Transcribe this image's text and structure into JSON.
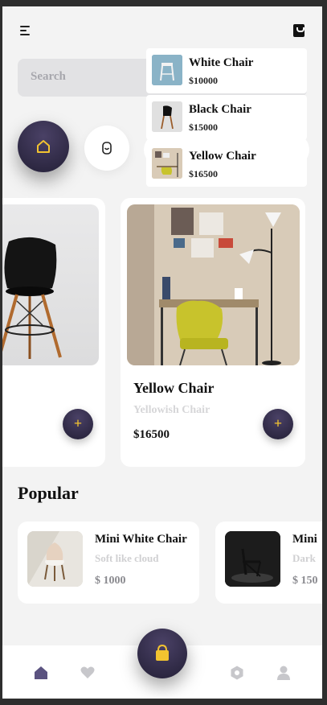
{
  "search": {
    "placeholder": "Search"
  },
  "dropdown": [
    {
      "name": "White Chair",
      "price": "$10000"
    },
    {
      "name": "Black Chair",
      "price": "$15000"
    },
    {
      "name": "Yellow Chair",
      "price": "$16500"
    }
  ],
  "featured": [
    {
      "title_visible": "r"
    },
    {
      "title": "Yellow Chair",
      "subtitle": "Yellowish Chair",
      "price": "$16500",
      "add": "+"
    }
  ],
  "featured_first_add": "+",
  "popular": {
    "title": "Popular",
    "items": [
      {
        "name": "Mini White Chair",
        "subtitle": "Soft like cloud",
        "price": "$ 1000"
      },
      {
        "name": "Mini",
        "subtitle": "Dark",
        "price": "$ 150"
      }
    ]
  },
  "colors": {
    "accent": "#2d2841",
    "highlight": "#f2c330",
    "nav_active": "#5b5380",
    "nav_inactive": "#c7c7cb"
  },
  "icons": [
    "menu-icon",
    "bag-icon",
    "home-icon",
    "mouse-icon",
    "plus-icon",
    "heart-icon",
    "settings-icon",
    "profile-icon",
    "shopping-bag-icon"
  ]
}
